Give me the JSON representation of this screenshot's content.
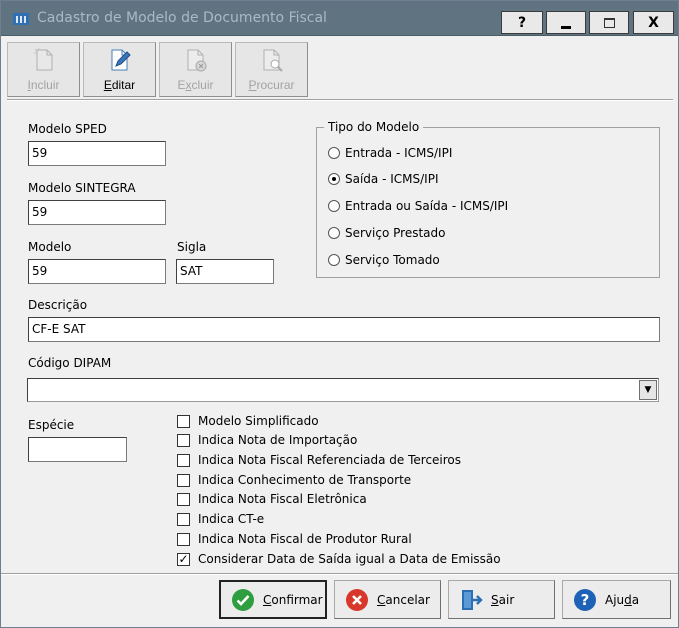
{
  "window": {
    "title": "Cadastro de Modelo de Documento Fiscal",
    "help_label": "?",
    "close_label": "X"
  },
  "toolbar": {
    "incluir": {
      "pre": "",
      "key": "I",
      "post": "ncluir",
      "enabled": false
    },
    "editar": {
      "pre": "",
      "key": "E",
      "post": "ditar",
      "enabled": true
    },
    "excluir": {
      "pre": "E",
      "key": "x",
      "post": "cluir",
      "enabled": false
    },
    "procurar": {
      "pre": "",
      "key": "P",
      "post": "rocurar",
      "enabled": false
    }
  },
  "form": {
    "modelo_sped": {
      "label": "Modelo SPED",
      "value": "59"
    },
    "modelo_sintegra": {
      "label": "Modelo SINTEGRA",
      "value": "59"
    },
    "modelo": {
      "label": "Modelo",
      "value": "59"
    },
    "sigla": {
      "label": "Sigla",
      "value": "SAT"
    },
    "descricao": {
      "label": "Descrição",
      "value": "CF-E SAT"
    },
    "codigo_dipam": {
      "label": "Código DIPAM",
      "value": ""
    },
    "especie": {
      "label": "Espécie",
      "value": ""
    }
  },
  "tipo_modelo": {
    "title": "Tipo do Modelo",
    "options": [
      {
        "label": "Entrada - ICMS/IPI",
        "selected": false
      },
      {
        "label": "Saída - ICMS/IPI",
        "selected": true
      },
      {
        "label": "Entrada ou Saída - ICMS/IPI",
        "selected": false
      },
      {
        "label": "Serviço Prestado",
        "selected": false
      },
      {
        "label": "Serviço Tomado",
        "selected": false
      }
    ]
  },
  "checkboxes": [
    {
      "label": "Modelo Simplificado",
      "checked": false
    },
    {
      "label": "Indica Nota de Importação",
      "checked": false
    },
    {
      "label": "Indica Nota Fiscal Referenciada de Terceiros",
      "checked": false
    },
    {
      "label": "Indica Conhecimento de Transporte",
      "checked": false
    },
    {
      "label": "Indica Nota Fiscal Eletrônica",
      "checked": false
    },
    {
      "label": "Indica CT-e",
      "checked": false
    },
    {
      "label": "Indica Nota Fiscal de Produtor Rural",
      "checked": false
    },
    {
      "label": "Considerar Data de Saída igual a Data de Emissão",
      "checked": true
    }
  ],
  "actions": {
    "confirmar": {
      "pre": "",
      "key": "C",
      "post": "onfirmar"
    },
    "cancelar": {
      "pre": "",
      "key": "C",
      "post": "ancelar"
    },
    "sair": {
      "pre": "",
      "key": "S",
      "post": "air"
    },
    "ajuda": {
      "pre": "Aju",
      "key": "d",
      "post": "a"
    }
  },
  "colors": {
    "titlebar": "#5f7380",
    "title_text": "#a9bac4",
    "confirm_green": "#2e9e3e",
    "cancel_red": "#d8382c",
    "exit_blue": "#2a6fb3",
    "help_blue": "#1e62b8"
  }
}
